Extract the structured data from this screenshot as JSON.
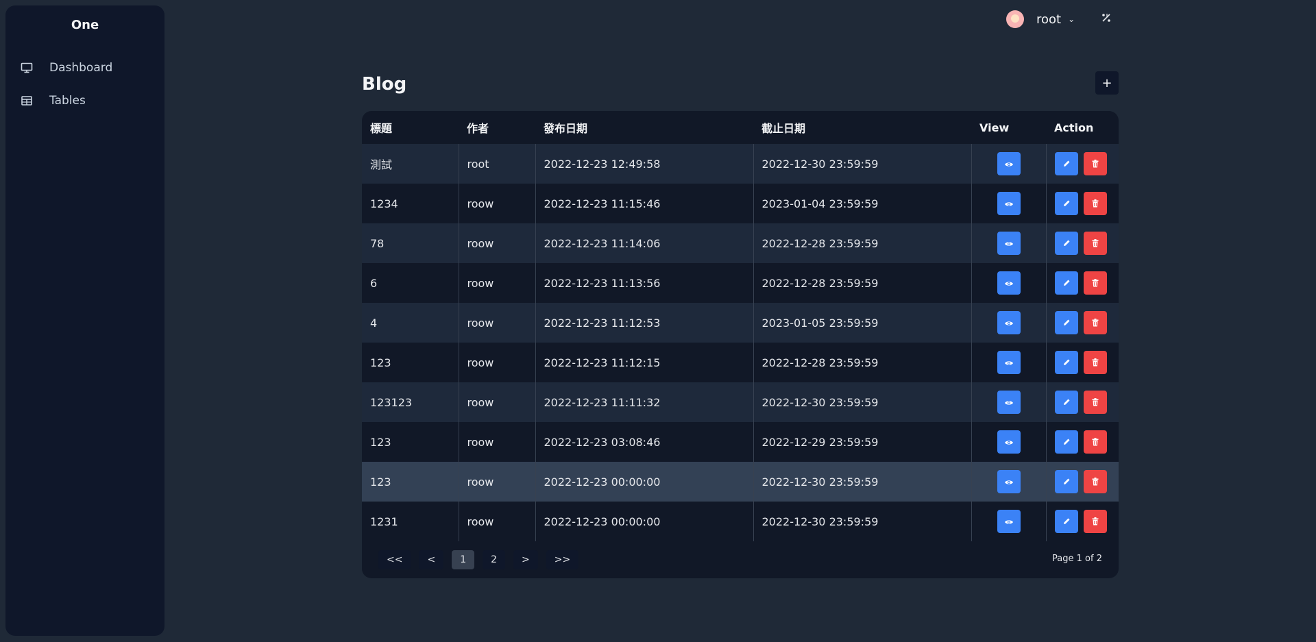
{
  "sidebar": {
    "brand": "One",
    "items": [
      {
        "label": "Dashboard"
      },
      {
        "label": "Tables"
      }
    ]
  },
  "topbar": {
    "user": "root"
  },
  "page": {
    "title": "Blog",
    "add_label": "+"
  },
  "table": {
    "headers": [
      "標題",
      "作者",
      "發布日期",
      "截止日期",
      "View",
      "Action"
    ],
    "rows": [
      [
        "測試",
        "root",
        "2022-12-23 12:49:58",
        "2022-12-30 23:59:59"
      ],
      [
        "1234",
        "roow",
        "2022-12-23 11:15:46",
        "2023-01-04 23:59:59"
      ],
      [
        "78",
        "roow",
        "2022-12-23 11:14:06",
        "2022-12-28 23:59:59"
      ],
      [
        "6",
        "roow",
        "2022-12-23 11:13:56",
        "2022-12-28 23:59:59"
      ],
      [
        "4",
        "roow",
        "2022-12-23 11:12:53",
        "2023-01-05 23:59:59"
      ],
      [
        "123",
        "roow",
        "2022-12-23 11:12:15",
        "2022-12-28 23:59:59"
      ],
      [
        "123123",
        "roow",
        "2022-12-23 11:11:32",
        "2022-12-30 23:59:59"
      ],
      [
        "123",
        "roow",
        "2022-12-23 03:08:46",
        "2022-12-29 23:59:59"
      ],
      [
        "123",
        "roow",
        "2022-12-23 00:00:00",
        "2022-12-30 23:59:59"
      ],
      [
        "1231",
        "roow",
        "2022-12-23 00:00:00",
        "2022-12-30 23:59:59"
      ]
    ]
  },
  "pager": {
    "first": "<<",
    "prev": "<",
    "pages": [
      "1",
      "2"
    ],
    "next": ">",
    "last": ">>",
    "info": "Page 1 of 2"
  },
  "colors": {
    "bg": "#1f2937",
    "sidebar": "#0f172a",
    "view_button": "#3b82f6",
    "edit_button": "#3b82f6",
    "delete_button": "#ef4444"
  },
  "icons": {
    "dashboard": "monitor-icon",
    "tables": "table-icon",
    "view": "eye-icon",
    "edit": "pencil-icon",
    "delete": "trash-icon",
    "theme": "theme-toggle-icon"
  }
}
